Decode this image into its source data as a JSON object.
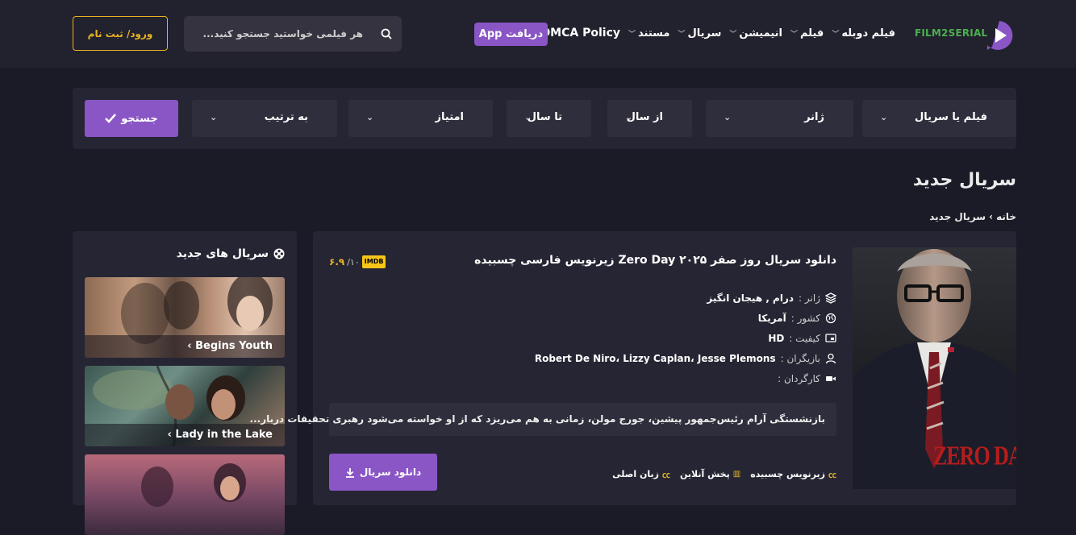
{
  "header": {
    "logo_text": "FILM2SERIAL",
    "nav": [
      {
        "label": "فیلم دوبله",
        "dropdown": true
      },
      {
        "label": "فیلم",
        "dropdown": true
      },
      {
        "label": "انیمیشن",
        "dropdown": true
      },
      {
        "label": "سریال",
        "dropdown": true
      },
      {
        "label": "مستند",
        "dropdown": true
      },
      {
        "label": "DMCA Policy",
        "dropdown": false
      }
    ],
    "app_label": "دریافت App",
    "search_placeholder": "هر فیلمی خواستید جستجو کنید...",
    "login_label": "ورود/ ثبت نام"
  },
  "filters": {
    "type_label": "فیلم یا سریال",
    "genre_label": "ژانر",
    "from_year_label": "از سال",
    "to_year_label": "تا سال",
    "rating_label": "امتیاز",
    "sort_label": "به ترتیب",
    "search_label": "جستجو"
  },
  "page": {
    "title": "سریال جدید",
    "breadcrumb_home": "خانه",
    "breadcrumb_sep": "›",
    "breadcrumb_current": "سریال جدید"
  },
  "sidebar": {
    "title": "سریال های جدید",
    "items": [
      {
        "label": "Begins Youth ›"
      },
      {
        "label": "Lady in the Lake ›"
      },
      {
        "label": ""
      }
    ]
  },
  "post": {
    "title": "دانلود سریال روز صفر Zero Day ۲۰۲۵ زیرنویس فارسی چسبیده",
    "imdb_badge": "IMDB",
    "imdb_score": "۶.۹",
    "imdb_max": "/۱۰",
    "genre_key": "ژانر :",
    "genre_value": "درام , هیجان انگیز",
    "country_key": "کشور :",
    "country_value": "آمریکا",
    "quality_key": "کیفیت :",
    "quality_value": "HD",
    "cast_key": "بازیگران :",
    "cast_value": "Robert De Niro، Lizzy Caplan، Jesse Plemons",
    "director_key": "کارگردان :",
    "director_value": "",
    "synopsis": "بازنشستگی آرام رئیس‌جمهور پیشین، جورج مولن، زمانی به هم می‌ریزد که از او خواسته می‌شود رهبری تحقیقات دربار...",
    "download_label": "دانلود سریال",
    "tags": [
      "زیرنویس چسبیده",
      "پخش آنلاین",
      "زبان اصلی"
    ],
    "poster_text": "ZERO DAY"
  },
  "colors": {
    "accent": "#8a56c6",
    "gold": "#e6b422",
    "background": "#1b1b27",
    "panel": "#262533"
  }
}
